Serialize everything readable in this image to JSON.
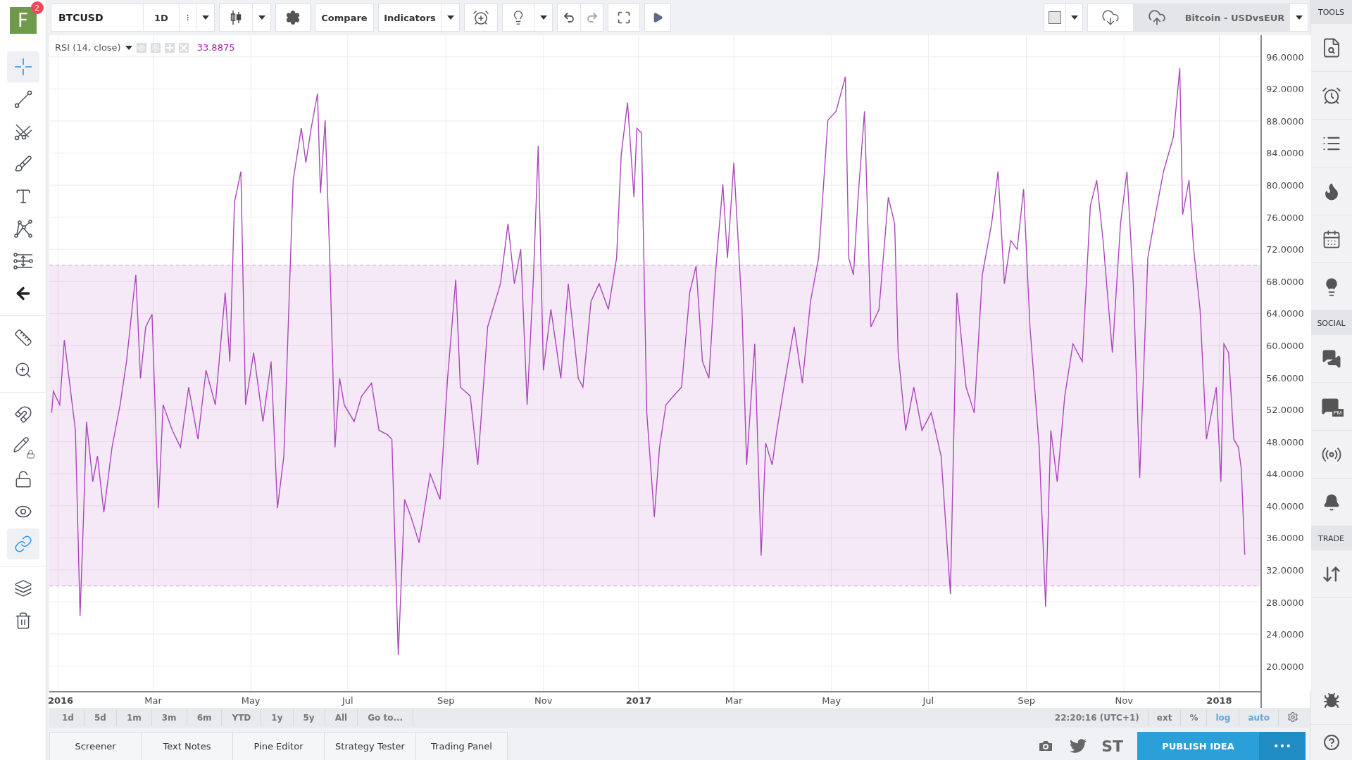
{
  "logo": {
    "letter": "F",
    "badge": "2"
  },
  "left_tools": [
    {
      "selected": true
    },
    {
      "selected": false
    },
    {
      "selected": false
    },
    {
      "selected": false
    },
    {
      "selected": false
    },
    {
      "selected": false
    },
    {
      "selected": false
    },
    {
      "selected": false
    },
    {
      "selected": false
    },
    {
      "selected": false
    },
    {
      "selected": false
    },
    {
      "selected": false
    },
    {
      "selected": false
    },
    {
      "selected": false
    },
    {
      "selected": true
    },
    {
      "selected": false
    },
    {
      "selected": false
    }
  ],
  "top_bar": {
    "symbol": "BTCUSD",
    "interval": "1D",
    "compare": "Compare",
    "indicators": "Indicators",
    "layout_name": "Bitcoin - USDvsEUR"
  },
  "legend": {
    "title": "RSI (14, close)",
    "value": "33.8875"
  },
  "chart_data": {
    "type": "line",
    "xlim": [
      2015.985,
      2018.071
    ],
    "ylim": [
      16.9,
      98.7
    ],
    "xticks": [
      {
        "value": 2016,
        "label": "2016"
      },
      {
        "value": 2016.164,
        "label": "Mar"
      },
      {
        "value": 2016.332,
        "label": "May"
      },
      {
        "value": 2016.499,
        "label": "Jul"
      },
      {
        "value": 2016.668,
        "label": "Sep"
      },
      {
        "value": 2016.836,
        "label": "Nov"
      },
      {
        "value": 2017,
        "label": "2017"
      },
      {
        "value": 2017.164,
        "label": "Mar"
      },
      {
        "value": 2017.332,
        "label": "May"
      },
      {
        "value": 2017.499,
        "label": "Jul"
      },
      {
        "value": 2017.668,
        "label": "Sep"
      },
      {
        "value": 2017.836,
        "label": "Nov"
      },
      {
        "value": 2018,
        "label": "2018"
      }
    ],
    "yticks": [
      {
        "value": 20,
        "label": "20.0000"
      },
      {
        "value": 24,
        "label": "24.0000"
      },
      {
        "value": 28,
        "label": "28.0000"
      },
      {
        "value": 32,
        "label": "32.0000"
      },
      {
        "value": 36,
        "label": "36.0000"
      },
      {
        "value": 40,
        "label": "40.0000"
      },
      {
        "value": 44,
        "label": "44.0000"
      },
      {
        "value": 48,
        "label": "48.0000"
      },
      {
        "value": 52,
        "label": "52.0000"
      },
      {
        "value": 56,
        "label": "56.0000"
      },
      {
        "value": 60,
        "label": "60.0000"
      },
      {
        "value": 64,
        "label": "64.0000"
      },
      {
        "value": 68,
        "label": "68.0000"
      },
      {
        "value": 72,
        "label": "72.0000"
      },
      {
        "value": 76,
        "label": "76.0000"
      },
      {
        "value": 80,
        "label": "80.0000"
      },
      {
        "value": 84,
        "label": "84.0000"
      },
      {
        "value": 88,
        "label": "88.0000"
      },
      {
        "value": 92,
        "label": "92.0000"
      },
      {
        "value": 96,
        "label": "96.0000"
      }
    ],
    "grid": true,
    "bands": [
      {
        "axis": "y",
        "from": 30,
        "to": 70,
        "color": "#9c27b0"
      }
    ],
    "ref_lines": [
      {
        "axis": "y",
        "value": 70,
        "color": "#c9a6d6"
      },
      {
        "axis": "y",
        "value": 30,
        "color": "#c9a6d6"
      }
    ],
    "x": [
      2015.989,
      2015.992,
      2016.003,
      2016.011,
      2016.03,
      2016.038,
      2016.044,
      2016.049,
      2016.06,
      2016.068,
      2016.079,
      2016.093,
      2016.107,
      2016.118,
      2016.129,
      2016.134,
      2016.142,
      2016.151,
      2016.162,
      2016.173,
      2016.181,
      2016.197,
      2016.211,
      2016.225,
      2016.241,
      2016.255,
      2016.271,
      2016.288,
      2016.296,
      2016.304,
      2016.315,
      2016.323,
      2016.337,
      2016.353,
      2016.367,
      2016.378,
      2016.389,
      2016.405,
      2016.419,
      2016.427,
      2016.436,
      2016.447,
      2016.452,
      2016.46,
      2016.468,
      2016.477,
      2016.485,
      2016.493,
      2016.51,
      2016.523,
      2016.54,
      2016.553,
      2016.567,
      2016.575,
      2016.586,
      2016.597,
      2016.608,
      2016.622,
      2016.641,
      2016.658,
      2016.671,
      2016.685,
      2016.693,
      2016.71,
      2016.723,
      2016.74,
      2016.762,
      2016.775,
      2016.786,
      2016.797,
      2016.808,
      2016.819,
      2016.827,
      2016.836,
      2016.849,
      2016.866,
      2016.879,
      2016.896,
      2016.904,
      2016.918,
      2016.932,
      2016.948,
      2016.962,
      2016.97,
      2016.981,
      2016.992,
      2016.997,
      2017.005,
      2017.014,
      2017.027,
      2017.036,
      2017.047,
      2017.06,
      2017.074,
      2017.088,
      2017.099,
      2017.11,
      2017.121,
      2017.132,
      2017.145,
      2017.153,
      2017.164,
      2017.178,
      2017.186,
      2017.2,
      2017.211,
      2017.219,
      2017.23,
      2017.238,
      2017.255,
      2017.268,
      2017.282,
      2017.296,
      2017.31,
      2017.326,
      2017.34,
      2017.356,
      2017.362,
      2017.37,
      2017.378,
      2017.389,
      2017.4,
      2017.414,
      2017.43,
      2017.441,
      2017.447,
      2017.46,
      2017.474,
      2017.488,
      2017.504,
      2017.521,
      2017.537,
      2017.548,
      2017.564,
      2017.578,
      2017.592,
      2017.608,
      2017.619,
      2017.63,
      2017.641,
      2017.652,
      2017.663,
      2017.674,
      2017.69,
      2017.701,
      2017.71,
      2017.721,
      2017.734,
      2017.748,
      2017.764,
      2017.778,
      2017.789,
      2017.8,
      2017.816,
      2017.83,
      2017.841,
      2017.852,
      2017.863,
      2017.877,
      2017.89,
      2017.904,
      2017.921,
      2017.932,
      2017.937,
      2017.948,
      2017.956,
      2017.967,
      2017.978,
      2017.995,
      2018.003,
      2018.008,
      2018.016,
      2018.025,
      2018.033,
      2018.038,
      2018.044
    ],
    "series": [
      {
        "color": "#ab47bc",
        "values": [
          51.6,
          54.3,
          52.6,
          60.7,
          49.4,
          26.3,
          38.6,
          50.5,
          43.0,
          46.2,
          39.2,
          47.3,
          52.6,
          58.0,
          65.5,
          68.8,
          55.9,
          62.3,
          63.9,
          39.7,
          52.6,
          49.4,
          47.3,
          54.8,
          48.3,
          56.9,
          52.6,
          66.6,
          58.0,
          77.9,
          81.7,
          52.6,
          59.1,
          50.5,
          58.0,
          39.7,
          46.2,
          80.6,
          87.1,
          82.8,
          87.1,
          91.4,
          79.0,
          88.1,
          70.9,
          47.3,
          55.9,
          52.6,
          50.5,
          53.7,
          55.3,
          49.4,
          48.9,
          48.3,
          21.4,
          40.8,
          38.6,
          35.4,
          44.0,
          40.8,
          55.9,
          68.2,
          54.8,
          53.7,
          45.1,
          62.3,
          67.7,
          75.2,
          67.7,
          72.0,
          52.6,
          68.8,
          84.9,
          56.9,
          64.5,
          55.9,
          67.7,
          55.9,
          54.8,
          65.5,
          67.7,
          64.5,
          70.9,
          83.8,
          90.3,
          78.5,
          87.1,
          86.5,
          51.6,
          38.6,
          47.3,
          52.6,
          53.7,
          54.8,
          66.6,
          69.9,
          58.0,
          55.9,
          68.8,
          80.1,
          70.9,
          82.8,
          64.5,
          45.1,
          60.2,
          33.8,
          47.8,
          45.1,
          49.4,
          56.9,
          62.3,
          55.3,
          65.5,
          70.9,
          88.1,
          89.2,
          93.5,
          70.9,
          68.8,
          78.5,
          89.2,
          62.3,
          64.5,
          78.5,
          75.2,
          59.1,
          49.4,
          54.8,
          49.4,
          51.6,
          46.2,
          29.0,
          66.6,
          54.8,
          51.6,
          68.8,
          75.2,
          81.7,
          67.7,
          73.1,
          72.0,
          79.5,
          62.3,
          47.3,
          27.4,
          49.4,
          43.0,
          53.7,
          60.2,
          58.0,
          77.4,
          80.6,
          73.1,
          59.1,
          75.2,
          81.7,
          67.7,
          43.5,
          70.9,
          76.3,
          81.7,
          86.0,
          94.6,
          76.3,
          80.6,
          72.0,
          64.5,
          48.3,
          54.8,
          43.0,
          60.2,
          59.1,
          48.3,
          47.3,
          44.6,
          33.9
        ]
      }
    ]
  },
  "time_range": {
    "buttons": [
      {
        "label": "1d"
      },
      {
        "label": "5d"
      },
      {
        "label": "1m"
      },
      {
        "label": "3m"
      },
      {
        "label": "6m"
      },
      {
        "label": "YTD"
      },
      {
        "label": "1y"
      },
      {
        "label": "5y"
      },
      {
        "label": "All"
      },
      {
        "label": "Go to..."
      }
    ],
    "clock": "22:20:16 (UTC+1)",
    "toggles": [
      {
        "label": "ext",
        "selected": false
      },
      {
        "label": "%",
        "selected": false
      },
      {
        "label": "log",
        "selected": true
      },
      {
        "label": "auto",
        "selected": true
      }
    ]
  },
  "bottom_tabs": [
    {
      "label": "Screener"
    },
    {
      "label": "Text Notes"
    },
    {
      "label": "Pine Editor"
    },
    {
      "label": "Strategy Tester"
    },
    {
      "label": "Trading Panel"
    }
  ],
  "bottom_right": {
    "st": "ST",
    "publish": "PUBLISH IDEA",
    "more": "• • •"
  },
  "right_sidebar": {
    "sections": [
      {
        "title": "TOOLS"
      },
      {
        "title": "SOCIAL"
      },
      {
        "title": "TRADE"
      }
    ],
    "pm_label": "PM"
  }
}
